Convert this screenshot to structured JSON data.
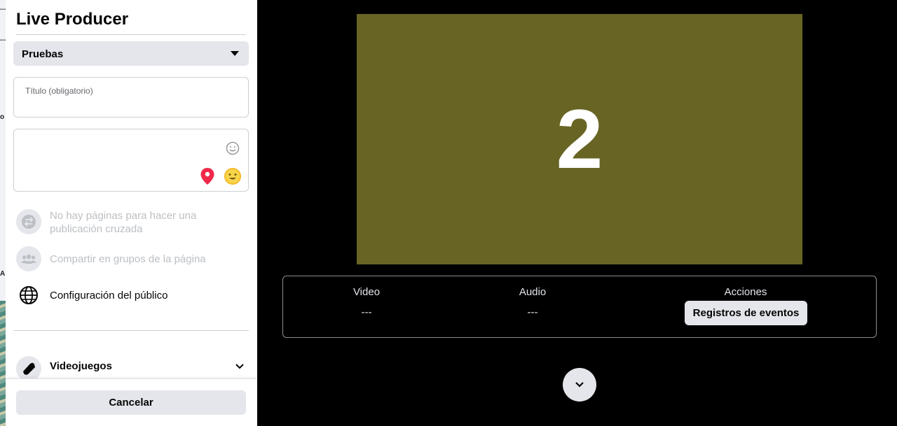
{
  "panel": {
    "title": "Live Producer",
    "page_selector": {
      "selected": "Pruebas"
    },
    "title_field": {
      "placeholder": "Título (obligatorio)",
      "value": ""
    },
    "description_field": {
      "value": ""
    },
    "options": [
      {
        "label": "No hay páginas para hacer una publicación cruzada",
        "enabled": false,
        "icon": "crosspost-icon"
      },
      {
        "label": "Compartir en grupos de la página",
        "enabled": false,
        "icon": "groups-icon"
      },
      {
        "label": "Configuración del público",
        "enabled": true,
        "icon": "globe-icon"
      }
    ],
    "games": {
      "label": "Videojuegos",
      "icon": "gamepad-icon"
    },
    "cancel_label": "Cancelar"
  },
  "preview": {
    "countdown": "2",
    "background": "#686424"
  },
  "stats": {
    "video_label": "Video",
    "video_value": "---",
    "audio_label": "Audio",
    "audio_value": "---",
    "actions_label": "Acciones",
    "events_button": "Registros de eventos"
  },
  "background_fragments": [
    "...",
    "...",
    "o",
    "A"
  ],
  "colors": {
    "panel_bg": "#ffffff",
    "button_bg": "#e4e6eb",
    "pin": "#f02849",
    "emoji": "#f7b928"
  }
}
